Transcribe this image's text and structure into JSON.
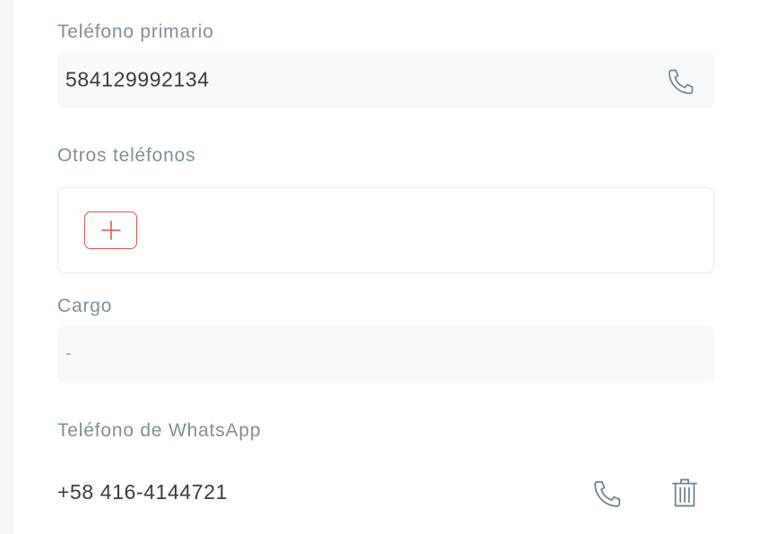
{
  "primary_phone": {
    "label": "Teléfono primario",
    "value": "584129992134",
    "call_icon": "phone-icon"
  },
  "other_phones": {
    "label": "Otros teléfonos",
    "add_icon": "plus-icon"
  },
  "position": {
    "label": "Cargo",
    "value": "-"
  },
  "whatsapp_phone": {
    "label": "Teléfono de WhatsApp",
    "value": "+58 416-4144721",
    "call_icon": "phone-icon",
    "delete_icon": "trash-icon"
  },
  "colors": {
    "accent": "#e0574f",
    "label": "#7c8f9e",
    "icon": "#6e8393",
    "field_bg": "#f8f9fb"
  }
}
